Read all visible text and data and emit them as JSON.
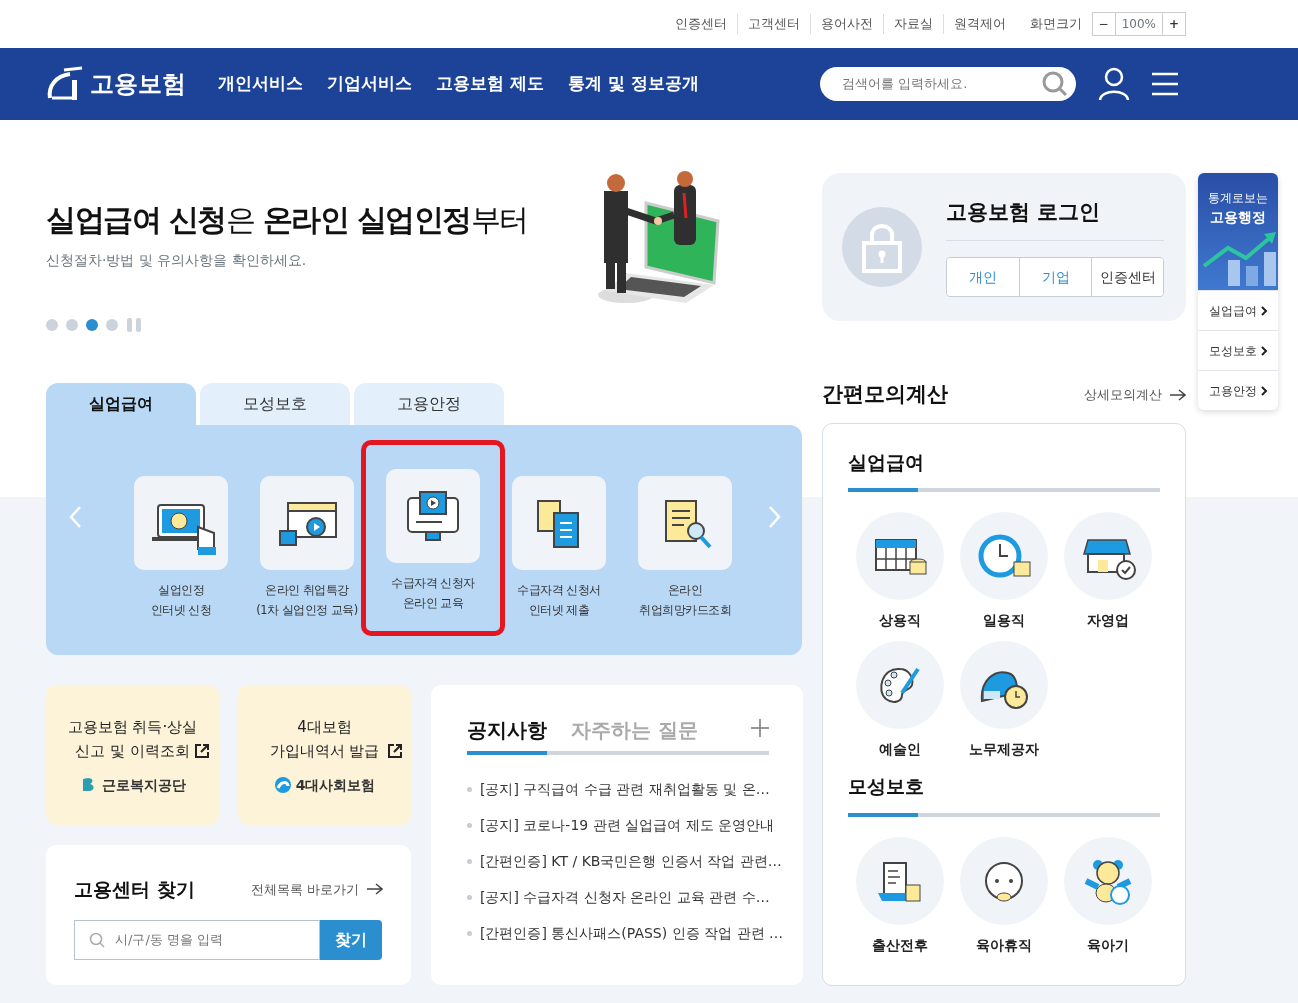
{
  "top_links": [
    {
      "label": "인증센터"
    },
    {
      "label": "고객센터"
    },
    {
      "label": "용어사전"
    },
    {
      "label": "자료실"
    },
    {
      "label": "원격제어"
    }
  ],
  "font_size": {
    "label": "화면크기",
    "minus": "−",
    "value": "100%",
    "plus": "+"
  },
  "nav": {
    "logo": "고용보험",
    "menu": [
      "개인서비스",
      "기업서비스",
      "고용보험 제도",
      "통계 및 정보공개"
    ],
    "search_placeholder": "검색어를 입력하세요."
  },
  "hero": {
    "title": "**실업급여 신청**은 **온라인 실업인정**부터",
    "subtitle": "신청절차·방법 및 유의사항을 확인하세요.",
    "dots": [
      {
        "selected": false
      },
      {
        "selected": false
      },
      {
        "selected": true
      },
      {
        "selected": false
      }
    ]
  },
  "service_tabs": [
    {
      "label": "실업급여",
      "selected": true
    },
    {
      "label": "모성보호",
      "selected": false
    },
    {
      "label": "고용안정",
      "selected": false
    }
  ],
  "services": [
    {
      "label": "실업인정\n인터넷 신청",
      "highlighted": false
    },
    {
      "label": "온라인 취업특강\n(1차 실업인정 교육)",
      "highlighted": false
    },
    {
      "label": "수급자격 신청자\n온라인 교육",
      "highlighted": true
    },
    {
      "label": "수급자격 신청서\n인터넷 제출",
      "highlighted": false
    },
    {
      "label": "온라인\n취업희망카드조회",
      "highlighted": false
    }
  ],
  "shortcuts": [
    {
      "text": "고용보험 취득·상실\n신고 및 이력조회",
      "org": "근로복지공단"
    },
    {
      "text": "4대보험\n가입내역서 발급",
      "org": "4대사회보험"
    }
  ],
  "center_search": {
    "title": "고용센터 찾기",
    "link": "전체목록 바로가기",
    "placeholder": "시/구/동 명을 입력",
    "button": "찾기"
  },
  "notices": {
    "tabs": [
      {
        "label": "공지사항",
        "selected": true
      },
      {
        "label": "자주하는 질문",
        "selected": false
      }
    ],
    "items": [
      "[공지] 구직급여 수급 관련 재취업활동 및 온…",
      "[공지] 코로나-19 관련 실업급여 제도 운영안내",
      "[간편인증] KT / KB국민은행 인증서 작업 관련…",
      "[공지] 수급자격 신청자 온라인 교육 관련 수…",
      "[간편인증] 통신사패스(PASS) 인증 작업 관련 …"
    ]
  },
  "login": {
    "title": "고용보험 로그인",
    "buttons": [
      {
        "label": "개인",
        "kind": "accent"
      },
      {
        "label": "기업",
        "kind": "accent"
      },
      {
        "label": "인증센터",
        "kind": "plain"
      }
    ]
  },
  "calculator": {
    "title": "간편모의계산",
    "link": "상세모의계산",
    "groups": [
      {
        "title": "실업급여",
        "items": [
          "상용직",
          "일용직",
          "자영업",
          "예술인",
          "노무제공자"
        ]
      },
      {
        "title": "모성보호",
        "items": [
          "출산전후",
          "육아휴직",
          "육아기"
        ]
      }
    ]
  },
  "quick_menu": {
    "caption": "통계로보는",
    "title": "고용행정",
    "items": [
      "실업급여",
      "모성보호",
      "고용안정"
    ]
  }
}
